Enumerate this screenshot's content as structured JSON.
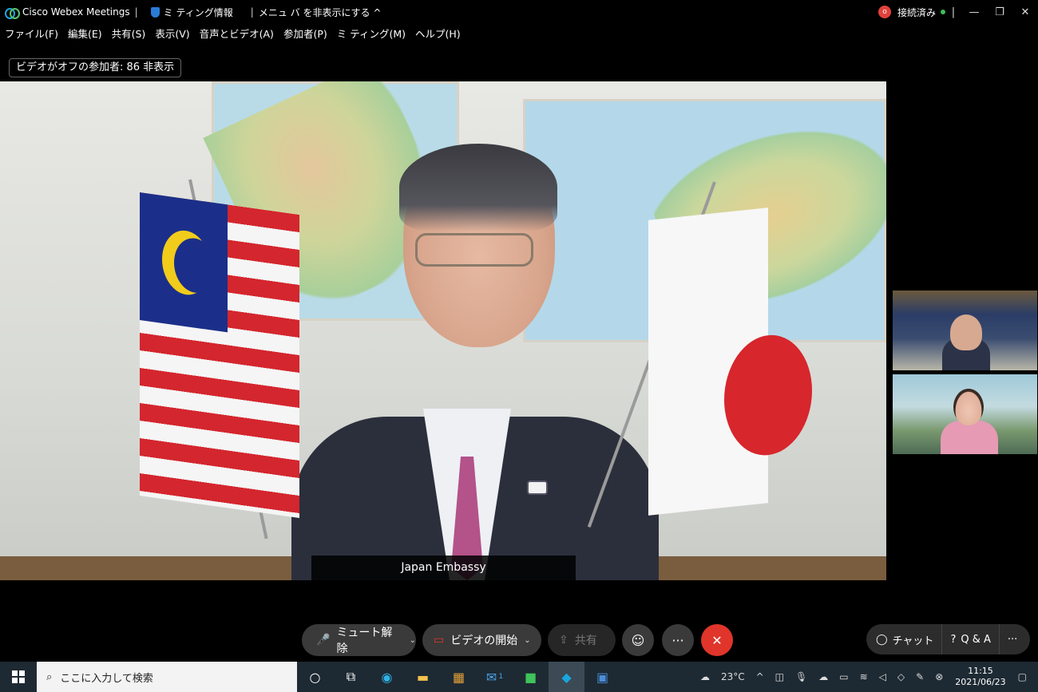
{
  "titlebar": {
    "app_name": "Cisco Webex Meetings",
    "meeting_info": "ミ ティング情報",
    "hide_menu": "メニュ バ を非表示にする",
    "rec_label": "o",
    "status": "接続済み"
  },
  "menu": [
    "ファイル(F)",
    "編集(E)",
    "共有(S)",
    "表示(V)",
    "音声とビデオ(A)",
    "参加者(P)",
    "ミ ティング(M)",
    "ヘルプ(H)"
  ],
  "hidden_participants": "ビデオがオフの参加者: 86 非表示",
  "main_video": {
    "name_label": "Japan Embassy"
  },
  "controls": {
    "unmute": "ミュート解除",
    "start_video": "ビデオの開始",
    "share": "共有",
    "more": "···",
    "end": "✕"
  },
  "panel": {
    "chat": "チャット",
    "qa": "Q & A",
    "more": "···"
  },
  "taskbar": {
    "search_placeholder": "ここに入力して検索",
    "mail_badge": "1",
    "weather": "23°C",
    "time": "11:15",
    "date": "2021/06/23"
  },
  "colors": {
    "end_button": "#e0352b",
    "connected": "#3fbf5a",
    "accent": "#1aa5e0"
  }
}
